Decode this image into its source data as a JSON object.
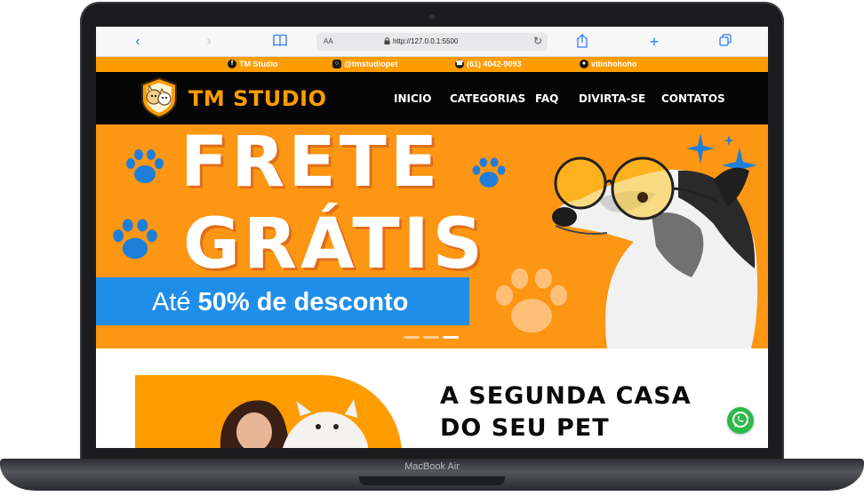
{
  "device": {
    "label": "MacBook Air"
  },
  "browser": {
    "text_size_label": "AA",
    "url": "http://127.0.0.1:5500"
  },
  "info_bar": {
    "items": [
      {
        "icon": "facebook-icon",
        "text": "TM Studio"
      },
      {
        "icon": "instagram-icon",
        "text": "@tmstudiopet"
      },
      {
        "icon": "whatsapp-icon",
        "text": "(61) 4042-9093"
      },
      {
        "icon": "github-icon",
        "text": "vitinhohoho"
      }
    ]
  },
  "nav": {
    "brand": "TM STUDIO",
    "links": [
      "INICIO",
      "CATEGORIAS",
      "FAQ",
      "DIVIRTA-SE",
      "CONTATOS"
    ]
  },
  "hero": {
    "title_line1": "FRETE",
    "title_line2": "GRÁTIS",
    "subtitle_prefix": "Até ",
    "subtitle_bold": "50% de desconto",
    "slide_count": 3,
    "active_slide": 3
  },
  "section": {
    "title": "A SEGUNDA CASA DO SEU PET"
  },
  "colors": {
    "brand_orange": "#ff9c00",
    "hero_orange": "#fd9613",
    "accent_blue": "#1f8ee9",
    "whatsapp_green": "#2fb84b"
  }
}
